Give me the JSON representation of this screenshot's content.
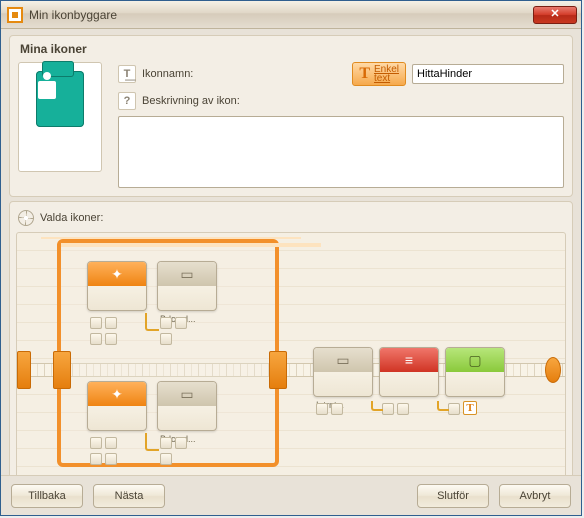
{
  "window": {
    "title": "Min ikonbyggare"
  },
  "panel": {
    "heading": "Mina ikoner",
    "name_label": "Ikonnamn:",
    "enkel_link1": "Enkel",
    "enkel_link2": "text",
    "name_value": "HittaHinder",
    "desc_label": "Beskrivning av ikon:",
    "desc_value": ""
  },
  "canvas": {
    "heading": "Valda ikoner:",
    "block_tag_bdcmd": "Bdcmd...",
    "block_tag_intrnt": "Intrnt...",
    "tport_glyph": "T"
  },
  "icons": {
    "close_glyph": "✕",
    "name_glyph": "T͟",
    "desc_glyph": "?",
    "head_plus": "✦",
    "head_case": "▭",
    "head_calc": "≡",
    "head_screen": "▢"
  },
  "footer": {
    "back": "Tillbaka",
    "next": "Nästa",
    "finish": "Slutför",
    "cancel": "Avbryt"
  }
}
